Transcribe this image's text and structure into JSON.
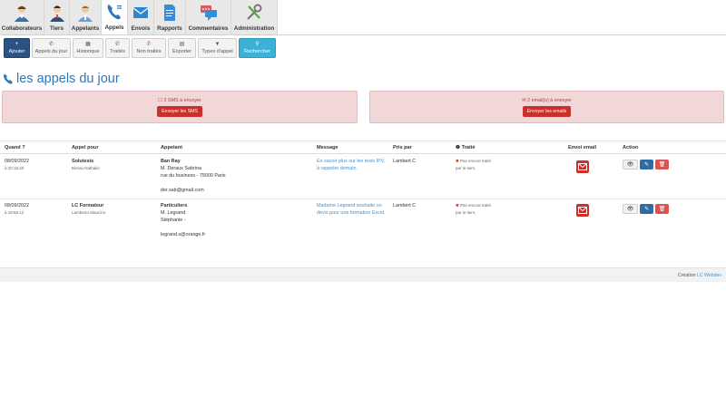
{
  "topnav": [
    {
      "label": "Collaborateurs",
      "icon": "collaborators-icon"
    },
    {
      "label": "Tiers",
      "icon": "tiers-icon"
    },
    {
      "label": "Appelants",
      "icon": "callers-icon"
    },
    {
      "label": "Appels",
      "icon": "calls-phone-icon",
      "active": true
    },
    {
      "label": "Envois",
      "icon": "envelope-icon"
    },
    {
      "label": "Rapports",
      "icon": "report-icon"
    },
    {
      "label": "Commentaires",
      "icon": "comments-icon"
    },
    {
      "label": "Administration",
      "icon": "admin-tools-icon"
    }
  ],
  "toolbar": [
    {
      "label": "Ajouter",
      "glyph": "+",
      "style": "primary"
    },
    {
      "label": "Appels du jour",
      "glyph": "✆"
    },
    {
      "label": "Historique",
      "glyph": "▦"
    },
    {
      "label": "Traités",
      "glyph": "✆"
    },
    {
      "label": "Non traités",
      "glyph": "✆"
    },
    {
      "label": "Exporter",
      "glyph": "▤"
    },
    {
      "label": "Types d'appel",
      "glyph": "▼"
    },
    {
      "label": "Rechercher",
      "glyph": "⚲",
      "style": "info"
    }
  ],
  "page_title": "les appels du jour",
  "alerts": {
    "sms": {
      "text": "2 SMS à envoyer",
      "icon": "☐",
      "button": "Envoyer les SMS"
    },
    "emails": {
      "text": "2 email(s) à envoyer",
      "icon": "✉",
      "button": "Envoyer les emails"
    }
  },
  "table": {
    "headers": {
      "quand": "Quand ?",
      "appel_pour": "Appel pour",
      "appelant": "Appelant",
      "message": "Message",
      "pris_par": "Pris par",
      "traite": "Traité",
      "envoi_email": "Envoi email",
      "action": "Action"
    },
    "rows": [
      {
        "date": "08/09/2022",
        "time": "à 20:16:40",
        "company": "Solutests",
        "contact": "Bireau Nathalie",
        "caller_name": "Ban Ray",
        "caller_person": "M. Deraux Sabrina",
        "caller_address": "rue du business - 75000 Paris",
        "caller_email": "der.sab@gmail.com",
        "message": "En savoir plus sur les tests IPV, à rappeler demain.",
        "taken_by": "Lambert C",
        "status_line1": "Pas encore traité",
        "status_line2": "par le tiers."
      },
      {
        "date": "08/09/2022",
        "time": "à 18:58:12",
        "company": "LC Formateur",
        "contact": "Lamberto Maurizio",
        "caller_name": "Particuliers",
        "caller_person": "M. Legrand",
        "caller_address": "Stéphanie -",
        "caller_email": "legrand.s@orange.fr",
        "message": "Madame Legrand souhaite un devis pour une formation Excel.",
        "taken_by": "Lambert C",
        "status_line1": "Pas encore traité",
        "status_line2": "par le tiers."
      }
    ]
  },
  "footer": {
    "prefix": "Création ",
    "link": "LC Webdev"
  },
  "colors": {
    "brand_blue": "#3178b6",
    "danger": "#c9302c",
    "primary": "#2b5283",
    "info": "#3bb1d8"
  }
}
